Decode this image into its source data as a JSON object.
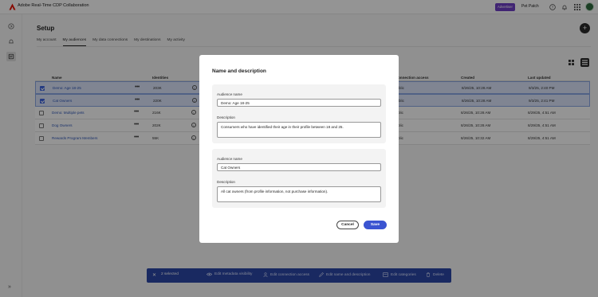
{
  "app": {
    "title": "Adobe Real-Time CDP Collaboration",
    "sandbox_badge": "Advertiser",
    "org_name": "Pet Patch"
  },
  "page": {
    "title": "Setup",
    "tabs": [
      {
        "label": "My account",
        "active": false
      },
      {
        "label": "My audiences",
        "active": true
      },
      {
        "label": "My data connections",
        "active": false
      },
      {
        "label": "My destinations",
        "active": false
      },
      {
        "label": "My activity",
        "active": false
      }
    ]
  },
  "table": {
    "headers": {
      "name": "Name",
      "identities": "Identities",
      "connection_access": "onnection access",
      "created": "Created",
      "last_updated": "Last updated"
    },
    "rows": [
      {
        "name": "Demo: Age 18-25",
        "identities": "203K",
        "access": "blic",
        "created": "8/26/25, 10:28 AM",
        "updated": "9/3/25, 2:40 PM",
        "selected": true
      },
      {
        "name": "Cat Owners",
        "identities": "220K",
        "access": "blic",
        "created": "8/26/25, 10:28 AM",
        "updated": "9/3/25, 2:41 PM",
        "selected": true
      },
      {
        "name": "Demo: Multiple pets",
        "identities": "216K",
        "access": "blic",
        "created": "8/26/25, 10:28 AM",
        "updated": "8/29/25, 4:51 AM",
        "selected": false
      },
      {
        "name": "Dog Owners",
        "identities": "202K",
        "access": "blic",
        "created": "8/26/25, 10:28 AM",
        "updated": "8/29/25, 4:51 AM",
        "selected": false
      },
      {
        "name": "Rewards Program Members",
        "identities": "55K",
        "access": "blic",
        "created": "8/26/25, 10:32 AM",
        "updated": "8/29/25, 4:51 AM",
        "selected": false
      }
    ]
  },
  "action_bar": {
    "selected_count": "2 selected",
    "items": [
      {
        "label": "Edit metadata visibility",
        "icon": "eye-icon"
      },
      {
        "label": "Edit connection access",
        "icon": "person-icon"
      },
      {
        "label": "Edit name and description",
        "icon": "pencil-icon"
      },
      {
        "label": "Edit categories",
        "icon": "category-icon"
      },
      {
        "label": "Delete",
        "icon": "trash-icon"
      }
    ]
  },
  "modal": {
    "title": "Name and description",
    "audiences": [
      {
        "name_label": "Audience name",
        "name_value": "Demo: Age 18-25",
        "description_label": "Description",
        "description_value": "Consumers who have identified their age in their profile between 18 and 25."
      },
      {
        "name_label": "Audience name",
        "name_value": "Cat Owners",
        "description_label": "Description",
        "description_value": "All cat owners (from profile information, not purchase information)."
      }
    ],
    "cancel_label": "Cancel",
    "save_label": "Save"
  },
  "colors": {
    "accent": "#3b54d1",
    "action_bar": "#2c48a8",
    "sandbox_badge": "#6f3ec7",
    "link": "#2d55b8",
    "brand_red": "#eb1000"
  }
}
